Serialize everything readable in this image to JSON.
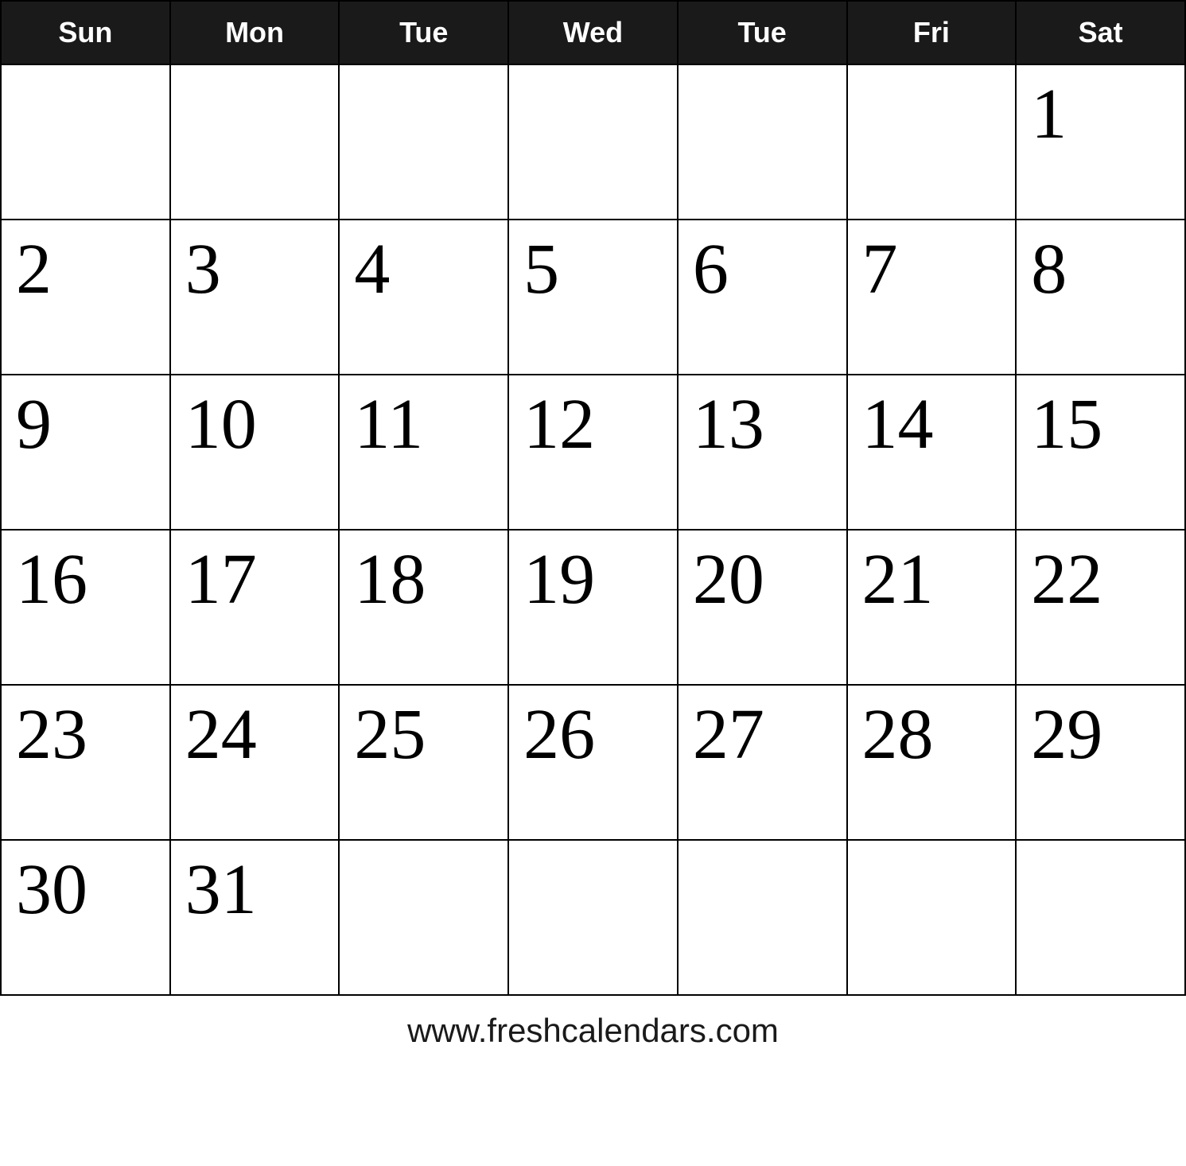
{
  "calendar": {
    "headers": [
      "Sun",
      "Mon",
      "Tue",
      "Wed",
      "Tue",
      "Fri",
      "Sat"
    ],
    "weeks": [
      [
        "",
        "",
        "",
        "",
        "",
        "",
        "1"
      ],
      [
        "2",
        "3",
        "4",
        "5",
        "6",
        "7",
        "8"
      ],
      [
        "9",
        "10",
        "11",
        "12",
        "13",
        "14",
        "15"
      ],
      [
        "16",
        "17",
        "18",
        "19",
        "20",
        "21",
        "22"
      ],
      [
        "23",
        "24",
        "25",
        "26",
        "27",
        "28",
        "29"
      ],
      [
        "30",
        "31",
        "",
        "",
        "",
        "",
        ""
      ]
    ]
  },
  "footer": {
    "url": "www.freshcalendars.com"
  }
}
